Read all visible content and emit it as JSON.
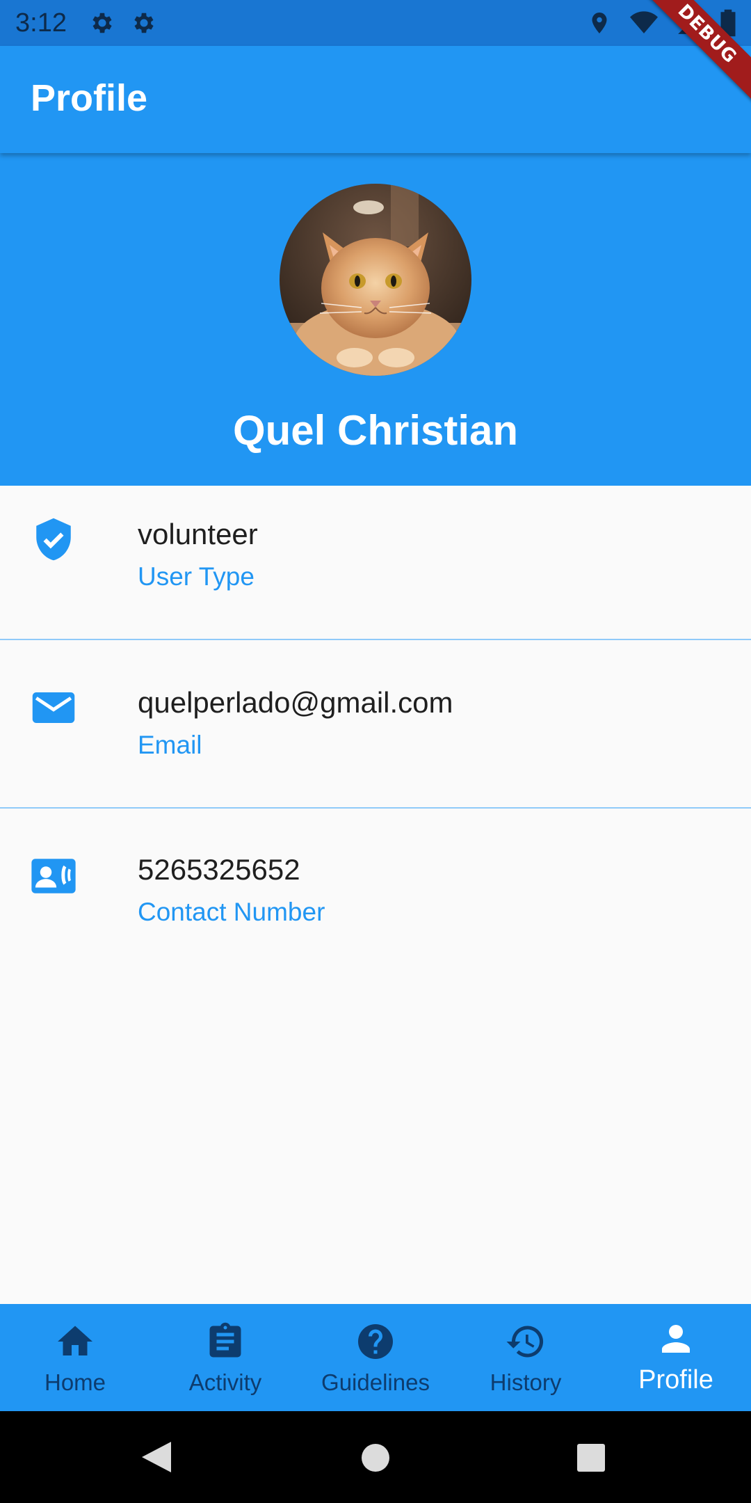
{
  "status_bar": {
    "time": "3:12",
    "debug_label": "DEBUG"
  },
  "app_bar": {
    "title": "Profile"
  },
  "profile": {
    "name": "Quel Christian"
  },
  "info_items": [
    {
      "value": "volunteer",
      "label": "User Type",
      "icon": "verified-shield-icon"
    },
    {
      "value": "quelperlado@gmail.com",
      "label": "Email",
      "icon": "mail-icon"
    },
    {
      "value": "5265325652",
      "label": "Contact Number",
      "icon": "contact-phone-icon"
    }
  ],
  "bottom_nav": [
    {
      "label": "Home",
      "icon": "home-icon",
      "active": false
    },
    {
      "label": "Activity",
      "icon": "clipboard-icon",
      "active": false
    },
    {
      "label": "Guidelines",
      "icon": "help-icon",
      "active": false
    },
    {
      "label": "History",
      "icon": "history-icon",
      "active": false
    },
    {
      "label": "Profile",
      "icon": "person-icon",
      "active": true
    }
  ],
  "colors": {
    "primary": "#2196f3",
    "status_bar": "#1976d2",
    "nav_inactive": "#0d3c6e",
    "divider": "#90caf9"
  }
}
